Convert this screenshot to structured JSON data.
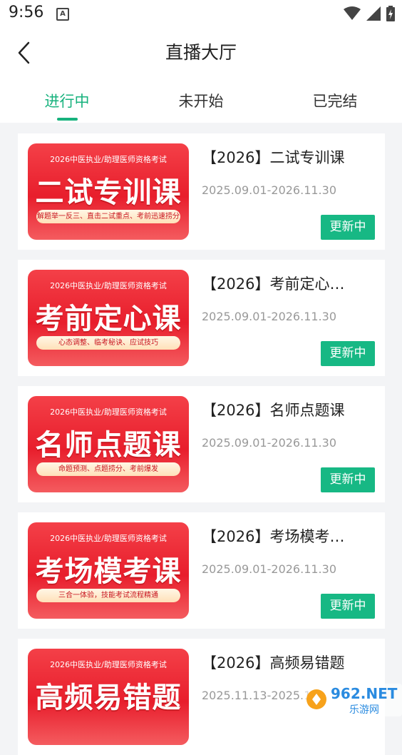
{
  "status_bar": {
    "time": "9:56",
    "notif_icon": "A"
  },
  "header": {
    "title": "直播大厅",
    "back_icon": "chevron-left-icon"
  },
  "tabs": [
    {
      "label": "进行中",
      "active": true
    },
    {
      "label": "未开始",
      "active": false
    },
    {
      "label": "已完结",
      "active": false
    }
  ],
  "accent_color": "#17b27d",
  "courses": [
    {
      "thumb_sub": "2026中医执业/助理医师资格考试",
      "thumb_big": "二试专训课",
      "thumb_pill": "解题举一反三、直击二试重点、考前迅速捞分",
      "title": "【2026】二试专训课",
      "date": "2025.09.01-2026.11.30",
      "badge": "更新中"
    },
    {
      "thumb_sub": "2026中医执业/助理医师资格考试",
      "thumb_big": "考前定心课",
      "thumb_pill": "心态调整、临考秘诀、应试技巧",
      "title": "【2026】考前定心…",
      "date": "2025.09.01-2026.11.30",
      "badge": "更新中"
    },
    {
      "thumb_sub": "2026中医执业/助理医师资格考试",
      "thumb_big": "名师点题课",
      "thumb_pill": "命题预测、点题捞分、考前爆发",
      "title": "【2026】名师点题课",
      "date": "2025.09.01-2026.11.30",
      "badge": "更新中"
    },
    {
      "thumb_sub": "2026中医执业/助理医师资格考试",
      "thumb_big": "考场模考课",
      "thumb_pill": "三合一体验，技能考试流程精通",
      "title": "【2026】考场模考…",
      "date": "2025.09.01-2026.11.30",
      "badge": "更新中"
    },
    {
      "thumb_sub": "2026中医执业/助理医师资格考试",
      "thumb_big": "高频易错题",
      "thumb_pill": "",
      "title": "【2026】高频易错题",
      "date": "2025.11.13-2025.12",
      "badge": ""
    }
  ],
  "watermark": {
    "text": "962.NET",
    "sub": "乐游网"
  }
}
